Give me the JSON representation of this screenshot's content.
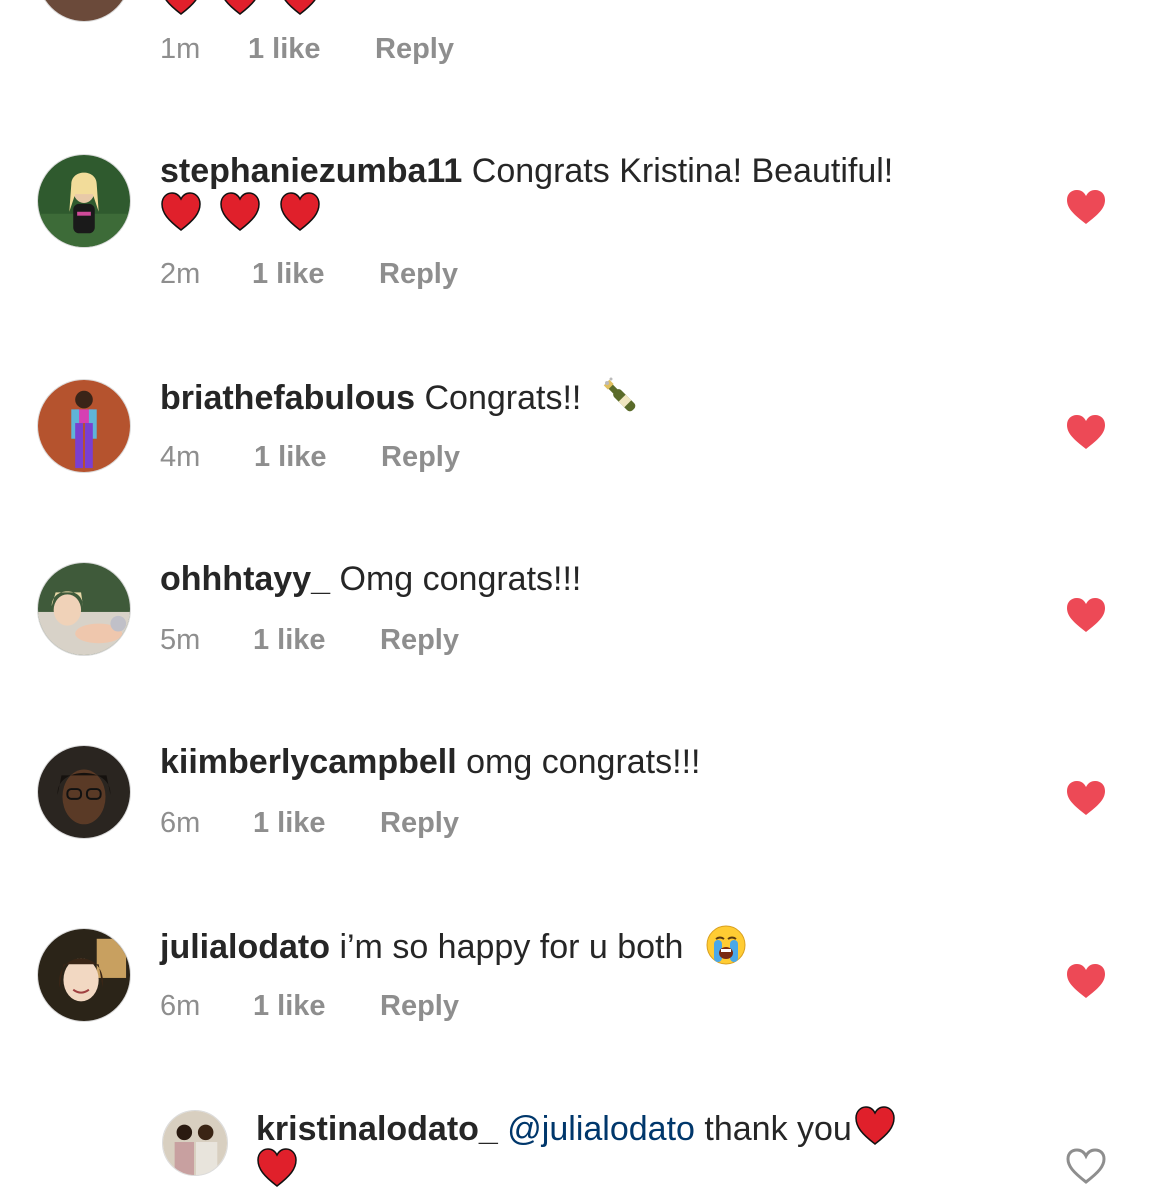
{
  "colors": {
    "like_red": "#ed4956",
    "meta_grey": "#8e8e8e",
    "mention_blue": "#00376b"
  },
  "top_comment": {
    "time": "1m",
    "likes": "1 like",
    "reply": "Reply"
  },
  "comments": [
    {
      "username": "stephaniezumba11",
      "text": "Congrats Kristina! Beautiful!",
      "emoji_line": "heart-emoji x3",
      "time": "2m",
      "likes": "1 like",
      "reply": "Reply",
      "liked": true
    },
    {
      "username": "briathefabulous",
      "text": "Congrats!!",
      "emoji": "champagne-emoji",
      "time": "4m",
      "likes": "1 like",
      "reply": "Reply",
      "liked": true
    },
    {
      "username": "ohhhtayy_",
      "text": "Omg congrats!!!",
      "time": "5m",
      "likes": "1 like",
      "reply": "Reply",
      "liked": true
    },
    {
      "username": "kiimberlycampbell",
      "text": "omg congrats!!!",
      "time": "6m",
      "likes": "1 like",
      "reply": "Reply",
      "liked": true
    },
    {
      "username": "julialodato",
      "text": "i’m so happy for u both",
      "emoji": "loudly-crying-face-emoji",
      "time": "6m",
      "likes": "1 like",
      "reply": "Reply",
      "liked": true
    }
  ],
  "reply": {
    "username": "kristinalodato_",
    "mention": "@julialodato",
    "text": "thank you",
    "emoji": "heart-emoji",
    "liked": false
  }
}
